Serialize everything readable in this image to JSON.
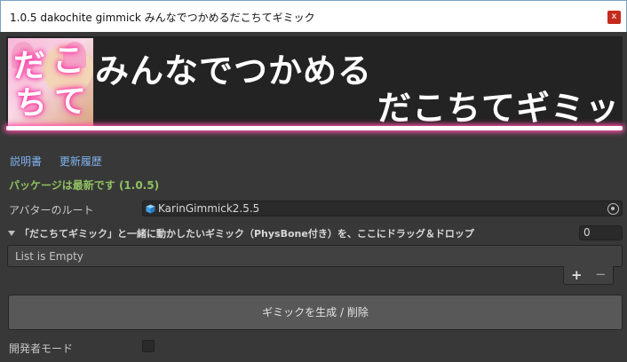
{
  "window": {
    "title": "1.0.5 dakochite gimmick みんなでつかめるだこちてギミック",
    "close_glyph": "x"
  },
  "banner": {
    "line1": "みんなでつかめる",
    "line2": "だこちてギミック",
    "logo_chars": [
      "だ",
      "こ",
      "ち",
      "て"
    ],
    "accent_color": "#ff4fa8"
  },
  "links": {
    "manual": "説明書",
    "changelog": "更新履歴"
  },
  "status": {
    "text": "パッケージは最新です (1.0.5)",
    "color": "#8fc060"
  },
  "avatar_root": {
    "label": "アバターのルート",
    "value": "KarinGimmick2.5.5",
    "icon": "prefab-cube-icon",
    "picker_icon": "object-picker-icon"
  },
  "gimmick_list": {
    "header": "「だこちてギミック」と一緒に動かしたいギミック（PhysBone付き）を、ここにドラッグ＆ドロップ",
    "size": "0",
    "empty_text": "List is Empty",
    "add": "+",
    "remove": "−"
  },
  "generate_button": {
    "label": "ギミックを生成 / 削除"
  },
  "developer_mode": {
    "label": "開発者モード",
    "checked": false
  }
}
